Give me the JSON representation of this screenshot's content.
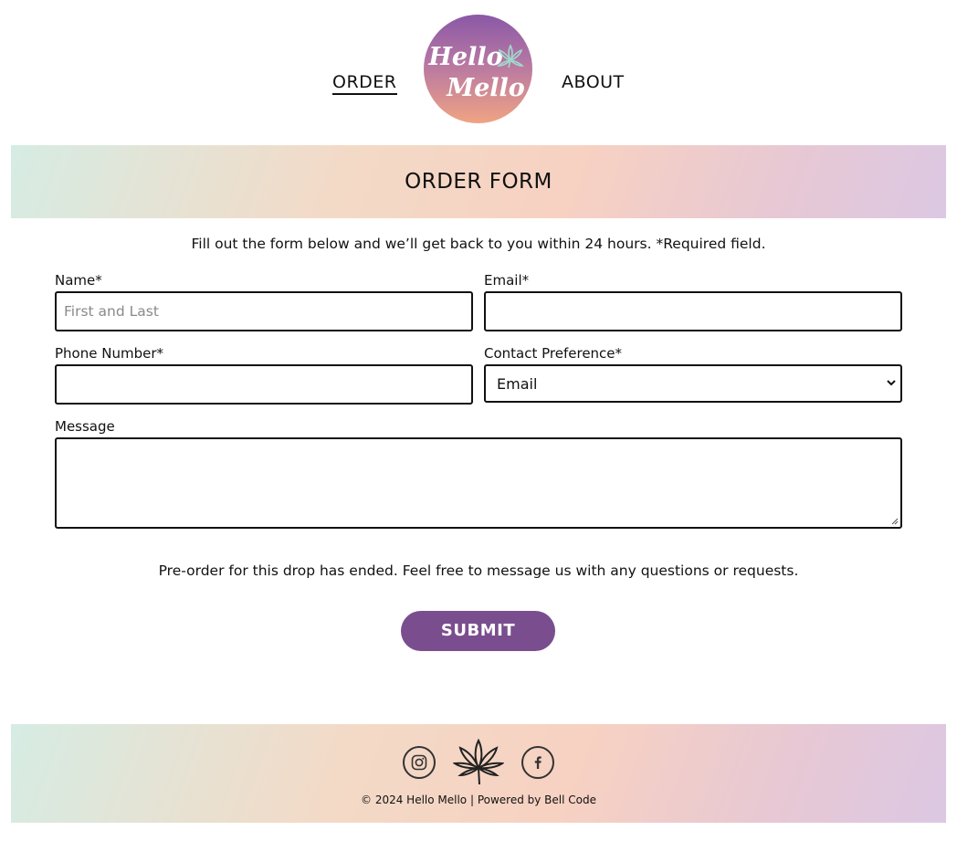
{
  "nav": {
    "order": "ORDER",
    "about": "ABOUT",
    "logo_line1": "Hello",
    "logo_line2": "Mello"
  },
  "banner": {
    "title": "ORDER FORM"
  },
  "intro": "Fill out the form below and we’ll get back to you within 24 hours. *Required field.",
  "form": {
    "name_label": "Name*",
    "name_placeholder": "First and Last",
    "name_value": "",
    "email_label": "Email*",
    "email_value": "",
    "phone_label": "Phone Number*",
    "phone_value": "",
    "contact_label": "Contact Preference*",
    "contact_selected": "Email",
    "message_label": "Message",
    "message_value": ""
  },
  "note": "Pre-order for this drop has ended. Feel free to message us with any questions or requests.",
  "submit_label": "SUBMIT",
  "footer": {
    "icons": [
      "instagram-icon",
      "cannabis-leaf-icon",
      "facebook-icon"
    ],
    "copyright": "© 2024 Hello Mello | Powered by Bell Code"
  },
  "colors": {
    "accent": "#7a4e8e",
    "logo_top": "#8a58a6",
    "logo_bottom": "#f0a383",
    "leaf_mint": "#9fd9cc"
  }
}
